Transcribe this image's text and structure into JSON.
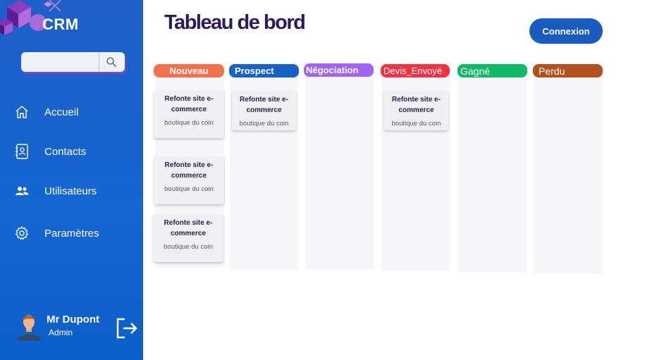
{
  "app": {
    "logo": "CRM",
    "title": "Tableau de bord",
    "login_button": "Connexion"
  },
  "search": {
    "placeholder": ""
  },
  "nav": {
    "items": [
      {
        "label": "Accueil",
        "icon": "home-icon"
      },
      {
        "label": "Contacts",
        "icon": "contacts-book-icon"
      },
      {
        "label": "Utilisateurs",
        "icon": "users-icon"
      },
      {
        "label": "Paramètres",
        "icon": "gear-icon"
      }
    ]
  },
  "user": {
    "name": "Mr Dupont",
    "role": "Admin"
  },
  "board": {
    "columns": [
      {
        "label": "Nouveau",
        "color": "#f4704f"
      },
      {
        "label": "Prospect",
        "color": "#1862c4"
      },
      {
        "label": "Négociation",
        "color": "#a363f2"
      },
      {
        "label": "Devis_Envoyé",
        "color": "#ee3344"
      },
      {
        "label": "Gagné",
        "color": "#11b866"
      },
      {
        "label": "Perdu",
        "color": "#b2511b"
      }
    ],
    "cards": [
      {
        "column": "Nouveau",
        "title": "Refonte site e-commerce",
        "client": "boutique du coin"
      },
      {
        "column": "Nouveau",
        "title": "Refonte site e-commerce",
        "client": "boutique du coin"
      },
      {
        "column": "Nouveau",
        "title": "Refonte site e-commerce",
        "client": "boutique du coin"
      },
      {
        "column": "Prospect",
        "title": "Refonte site e-commerce",
        "client": "boutique du coin"
      },
      {
        "column": "Devis_Envoyé",
        "title": "Refonte site e-commerce",
        "client": "boutique du coin"
      }
    ]
  },
  "colors": {
    "sidebar": "#1466d2",
    "title": "#2e1a56",
    "accent_purple": "#7b4bb8",
    "button": "#1a5bc0"
  }
}
